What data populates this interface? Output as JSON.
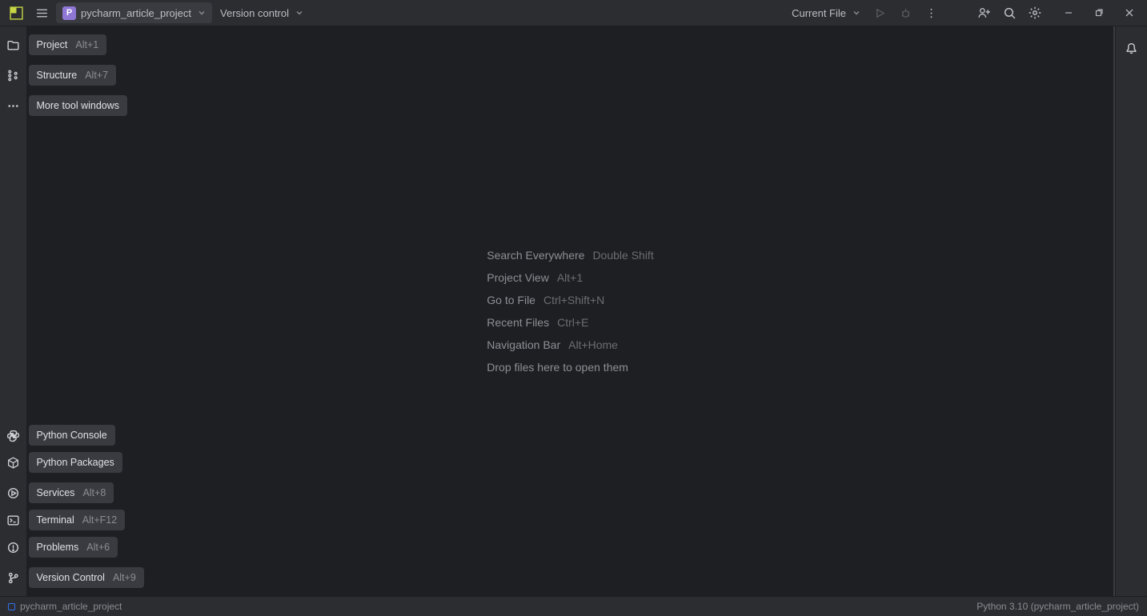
{
  "titlebar": {
    "project_initial": "P",
    "project_name": "pycharm_article_project",
    "vcs_label": "Version control",
    "run_config": "Current File"
  },
  "left_tools": {
    "project": {
      "label": "Project",
      "shortcut": "Alt+1"
    },
    "structure": {
      "label": "Structure",
      "shortcut": "Alt+7"
    },
    "more": {
      "label": "More tool windows"
    },
    "python_console": {
      "label": "Python Console"
    },
    "python_packages": {
      "label": "Python Packages"
    },
    "services": {
      "label": "Services",
      "shortcut": "Alt+8"
    },
    "terminal": {
      "label": "Terminal",
      "shortcut": "Alt+F12"
    },
    "problems": {
      "label": "Problems",
      "shortcut": "Alt+6"
    },
    "version_control": {
      "label": "Version Control",
      "shortcut": "Alt+9"
    }
  },
  "hints": {
    "search": {
      "label": "Search Everywhere",
      "shortcut": "Double Shift"
    },
    "project": {
      "label": "Project View",
      "shortcut": "Alt+1"
    },
    "goto": {
      "label": "Go to File",
      "shortcut": "Ctrl+Shift+N"
    },
    "recent": {
      "label": "Recent Files",
      "shortcut": "Ctrl+E"
    },
    "nav": {
      "label": "Navigation Bar",
      "shortcut": "Alt+Home"
    },
    "drop": {
      "label": "Drop files here to open them"
    }
  },
  "statusbar": {
    "breadcrumb": "pycharm_article_project",
    "interpreter": "Python 3.10 (pycharm_article_project)"
  }
}
